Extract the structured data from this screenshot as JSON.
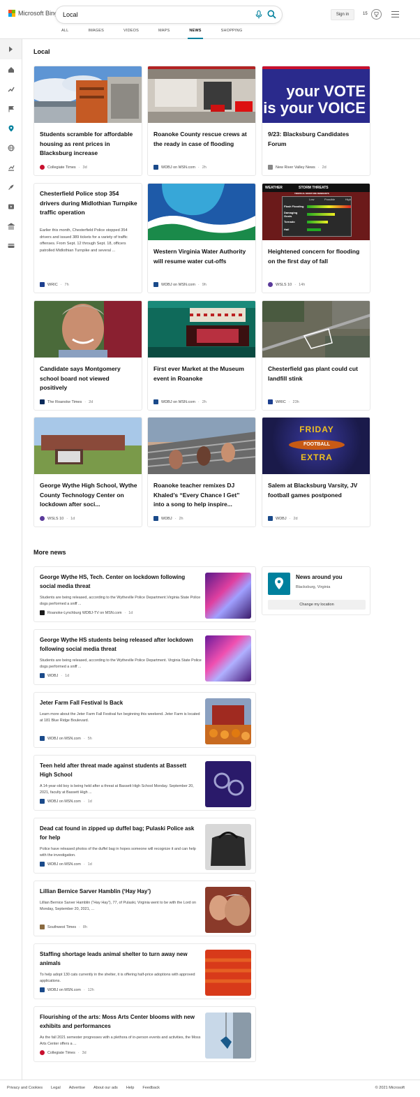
{
  "header": {
    "logo_text": "Microsoft Bing",
    "search_value": "Local",
    "sign_in": "Sign in",
    "rewards_count": "15"
  },
  "tabs": [
    "ALL",
    "IMAGES",
    "VIDEOS",
    "MAPS",
    "NEWS",
    "SHOPPING"
  ],
  "active_tab": "NEWS",
  "local": {
    "title": "Local",
    "cards": [
      {
        "title": "Students scramble for affordable housing as rent prices in Blacksburg increase",
        "source": "Collegiate Times",
        "ago": "3d",
        "snippet": ""
      },
      {
        "title": "Roanoke County rescue crews at the ready in case of flooding",
        "source": "WDBJ on MSN.com",
        "ago": "2h",
        "snippet": ""
      },
      {
        "title": "9/23: Blacksburg Candidates Forum",
        "source": "New River Valley News",
        "ago": "2d",
        "snippet": ""
      },
      {
        "title": "Chesterfield Police stop 354 drivers during Midlothian Turnpike traffic operation",
        "source": "WRIC",
        "ago": "7h",
        "snippet": "Earlier this month, Chesterfield Police stopped 354 drivers and issued 389 tickets for a variety of traffic offenses. From Sept. 12 through Sept. 18, officers patrolled Midlothian Turnpike and several ..."
      },
      {
        "title": "Western Virginia Water Authority will resume water cut-offs",
        "source": "WDBJ on MSN.com",
        "ago": "9h",
        "snippet": ""
      },
      {
        "title": "Heightened concern for flooding on the first day of fall",
        "source": "WSLS 10",
        "ago": "14h",
        "snippet": ""
      },
      {
        "title": "Candidate says Montgomery school board not viewed positively",
        "source": "The Roanoke Times",
        "ago": "2d",
        "snippet": ""
      },
      {
        "title": "First ever Market at the Museum event in Roanoke",
        "source": "WDBJ on MSN.com",
        "ago": "2h",
        "snippet": ""
      },
      {
        "title": "Chesterfield gas plant could cut landfill stink",
        "source": "WRIC",
        "ago": "23h",
        "snippet": ""
      },
      {
        "title": "George Wythe High School, Wythe County Technology Center on lockdown after soci...",
        "source": "WSLS 10",
        "ago": "1d",
        "snippet": ""
      },
      {
        "title": "Roanoke teacher remixes DJ Khaled’s “Every Chance I Get” into a song to help inspire...",
        "source": "WDBJ",
        "ago": "2h",
        "snippet": ""
      },
      {
        "title": "Salem at Blacksburg Varsity, JV football games postponed",
        "source": "WDBJ",
        "ago": "2d",
        "snippet": ""
      }
    ],
    "image_texts": {
      "vote_line1": "your VOTE",
      "vote_line2": "is your VOICE",
      "weather_logo": "WEATHER",
      "storm_title": "STORM THREATS",
      "storm_sub": "TROPICAL MOISTURE REMNANTS",
      "storm_rows": [
        "Flash Flooding",
        "Damaging Gusts",
        "Tornado",
        "Hail"
      ],
      "storm_cols": [
        "Low",
        "Possible",
        "High"
      ],
      "football_line1": "FRIDAY",
      "football_line2": "FOOTBALL",
      "football_line3": "EXTRA"
    }
  },
  "more_news": {
    "title": "More news",
    "items": [
      {
        "title": "George Wythe HS, Tech. Center on lockdown following social media threat",
        "snippet": "Students are being released, according to the Wytheville Police Department.Virginia State Police dogs performed a sniff ...",
        "source": "Roanoke-Lynchburg WDBJ-TV on MSN.com",
        "ago": "1d"
      },
      {
        "title": "George Wythe HS students being released after lockdown following social media threat",
        "snippet": "Students are being released, according to the Wytheville Police Department. Virginia State Police dogs performed a sniff ...",
        "source": "WDBJ",
        "ago": "1d"
      },
      {
        "title": "Jeter Farm Fall Festival Is Back",
        "snippet": "Learn more about the Jeter Farm Fall Festival fun beginning this weekend. Jeter Farm is located at 181 Blue Ridge Boulevard.",
        "source": "WDBJ on MSN.com",
        "ago": "5h"
      },
      {
        "title": "Teen held after threat made against students at Bassett High School",
        "snippet": "A 14-year-old boy is being held after a threat at Bassett High School Monday. September 20, 2021, faculty at Bassett High ...",
        "source": "WDBJ on MSN.com",
        "ago": "1d"
      },
      {
        "title": "Dead cat found in zipped up duffel bag; Pulaski Police ask for help",
        "snippet": "Police have released photos of the duffel bag in hopes someone will recognize it and can help with the investigation.",
        "source": "WDBJ on MSN.com",
        "ago": "1d"
      },
      {
        "title": "Lillian Bernice Sarver Hamblin (‘Hay Hay’)",
        "snippet": "Lillian Bernice Sarver Hamblin (“Hay Hay”), 77, of Pulaski, Virginia went to be with the Lord on Monday, September 20, 2021, ...",
        "source": "Southwest Times",
        "ago": "8h"
      },
      {
        "title": "Staffing shortage leads animal shelter to turn away new animals",
        "snippet": "To help adopt 130 cats currently in the shelter, it is offering half-price adoptions with approved applications.",
        "source": "WDBJ on MSN.com",
        "ago": "12h"
      },
      {
        "title": "Flourishing of the arts: Moss Arts Center blooms with new exhibits and performances",
        "snippet": "As the fall 2021 semester progresses with a plethora of in-person events and activities, the Moss Arts Center offers a ...",
        "source": "Collegiate Times",
        "ago": "3d"
      }
    ]
  },
  "around": {
    "title": "News around you",
    "location": "Blacksburg, Virginia",
    "button": "Change my location"
  },
  "footer": {
    "links": [
      "Privacy and Cookies",
      "Legal",
      "Advertise",
      "About our ads",
      "Help",
      "Feedback"
    ],
    "copyright": "© 2021 Microsoft"
  },
  "colors": {
    "accent": "#00809d",
    "ms_red": "#f25022",
    "ms_green": "#7fba00",
    "ms_blue": "#00a4ef",
    "ms_yellow": "#ffb900"
  }
}
